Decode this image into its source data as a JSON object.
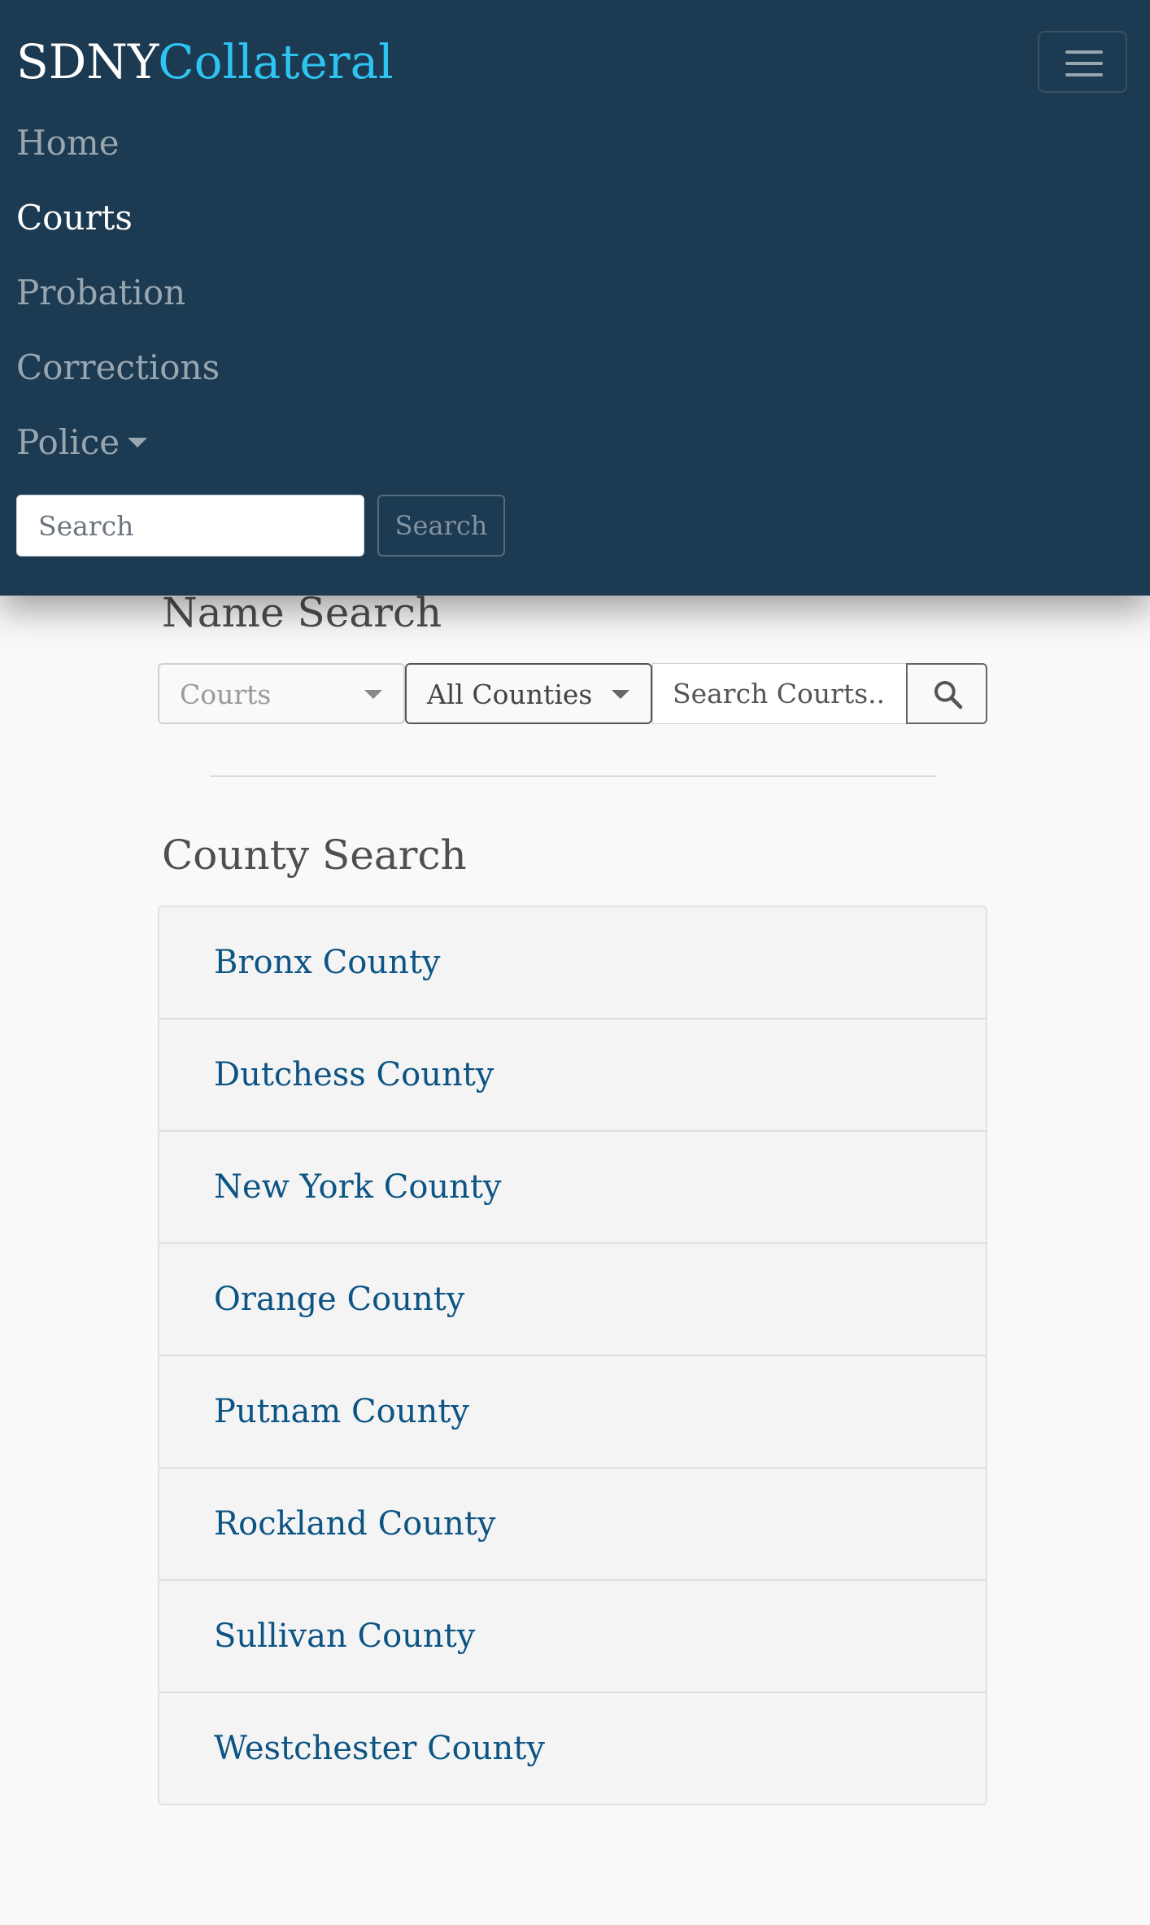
{
  "navbar": {
    "brand_part1": "SDNY",
    "brand_part2": "Collateral",
    "toggler_icon": "hamburger-menu-icon",
    "items": [
      {
        "label": "Home",
        "active": false
      },
      {
        "label": "Courts",
        "active": true
      },
      {
        "label": "Probation",
        "active": false
      },
      {
        "label": "Corrections",
        "active": false
      },
      {
        "label": "Police",
        "active": false,
        "dropdown": true
      }
    ],
    "search": {
      "placeholder": "Search",
      "button_label": "Search"
    }
  },
  "name_search": {
    "title": "Name Search",
    "category_select": "Courts",
    "county_select": "All Counties",
    "search_placeholder": "Search Courts...",
    "search_icon": "magnifier-icon"
  },
  "county_search": {
    "title": "County Search",
    "counties": [
      "Bronx County",
      "Dutchess County",
      "New York County",
      "Orange County",
      "Putnam County",
      "Rockland County",
      "Sullivan County",
      "Westchester County"
    ]
  },
  "colors": {
    "navbar_bg": "#1c3a51",
    "brand_accent": "#2ec4f1",
    "link": "#0c5484",
    "page_bg": "#f9f9f9"
  }
}
